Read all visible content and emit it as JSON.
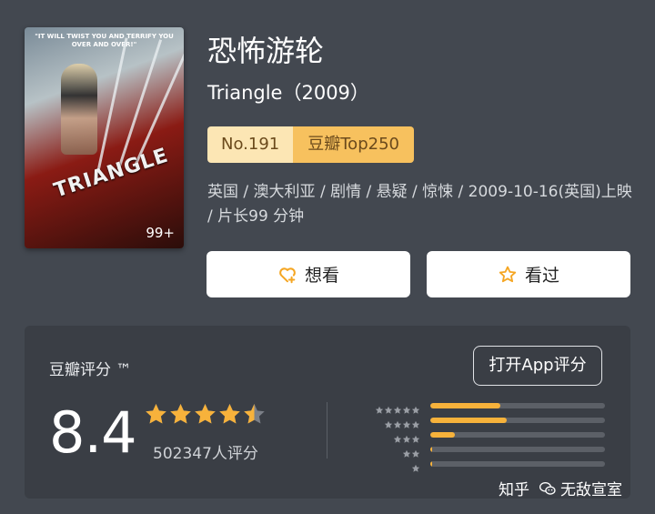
{
  "poster": {
    "tagline": "\"IT WILL TWIST YOU AND TERRIFY YOU OVER AND OVER!\"",
    "title": "TRIANGLE",
    "badge": "99+"
  },
  "movie": {
    "title_cn": "恐怖游轮",
    "title_en": "Triangle（2009）",
    "rank_no": "No.191",
    "rank_list": "豆瓣Top250",
    "meta": "英国 / 澳大利亚 / 剧情 / 悬疑 / 惊悚 / 2009-10-16(英国)上映 / 片长99 分钟"
  },
  "actions": {
    "wish_label": "想看",
    "seen_label": "看过"
  },
  "rating": {
    "label": "豆瓣评分 ™",
    "open_app": "打开App评分",
    "score": "8.4",
    "stars_value": 4.5,
    "votes": "502347人评分",
    "distribution": [
      {
        "stars": 5,
        "fraction": 0.4
      },
      {
        "stars": 4,
        "fraction": 0.44
      },
      {
        "stars": 3,
        "fraction": 0.14
      },
      {
        "stars": 2,
        "fraction": 0.01
      },
      {
        "stars": 1,
        "fraction": 0.01
      }
    ]
  },
  "watermark": {
    "site": "知乎",
    "author": "无敌宣室"
  },
  "colors": {
    "background": "#434850",
    "panel": "#3a3e45",
    "star": "#f7b23b",
    "rank_light": "#fce6b4",
    "rank_dark": "#f7c15e"
  },
  "icons": {
    "wish": "heart-plus-icon",
    "seen": "star-outline-icon",
    "watermark": "wechat-icon"
  }
}
